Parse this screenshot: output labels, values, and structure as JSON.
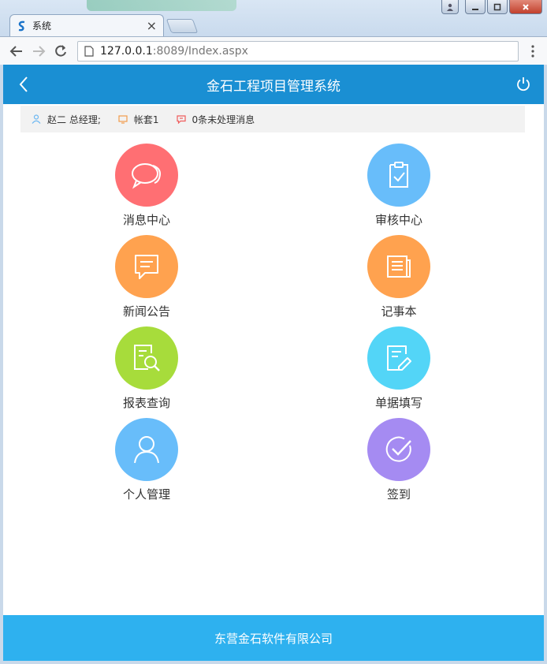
{
  "browser": {
    "tab_title": "系统",
    "url_host": "127.0.0.1",
    "url_rest": ":8089/Index.aspx"
  },
  "header": {
    "title": "金石工程项目管理系统"
  },
  "infobar": {
    "user": "赵二 总经理;",
    "account": "帐套1",
    "messages": "0条未处理消息"
  },
  "tiles": [
    {
      "label": "消息中心",
      "color": "#ff6f73",
      "icon": "chat-bubbles-icon"
    },
    {
      "label": "审核中心",
      "color": "#68bdfa",
      "icon": "approve-document-icon"
    },
    {
      "label": "新闻公告",
      "color": "#ffa24f",
      "icon": "announcement-icon"
    },
    {
      "label": "记事本",
      "color": "#ffa24f",
      "icon": "notebook-icon"
    },
    {
      "label": "报表查询",
      "color": "#a7dc3b",
      "icon": "report-search-icon"
    },
    {
      "label": "单据填写",
      "color": "#53d5f7",
      "icon": "edit-form-icon"
    },
    {
      "label": "个人管理",
      "color": "#68bdfa",
      "icon": "user-icon"
    },
    {
      "label": "签到",
      "color": "#a58bf2",
      "icon": "check-circle-icon"
    }
  ],
  "footer": {
    "company": "东营金石软件有限公司"
  },
  "colors": {
    "header_bg": "#1a8fd3",
    "footer_bg": "#2eb1ef"
  }
}
